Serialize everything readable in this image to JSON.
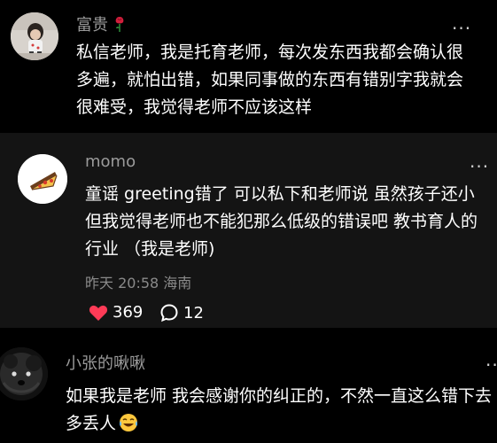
{
  "comments": [
    {
      "username": "富贵",
      "username_emoji": "rose-emoji",
      "more_label": "···",
      "text": "私信老师，我是托育老师，每次发东西我都会确认很多遍，就怕出错，如果同事做的东西有错别字我就会很难受，我觉得老师不应该这样"
    },
    {
      "username": "momo",
      "more_label": "···",
      "text": "童谣 greeting错了 可以私下和老师说 虽然孩子还小 但我觉得老师也不能犯那么低级的错误吧 教书育人的行业 （我是老师)",
      "meta": "昨天 20:58 海南",
      "likes": "369",
      "replies": "12"
    },
    {
      "username": "小张的啾啾",
      "more_label": "···",
      "text": "如果我是老师 我会感谢你的纠正的，不然一直这么错下去多丢人",
      "trailing_emoji": "crying-laughing-face-emoji"
    }
  ],
  "colors": {
    "like_heart": "#ff3b57",
    "background": "#000000",
    "highlight_background": "#141414",
    "username": "#9b9b9b",
    "meta": "#8a8a8a"
  }
}
